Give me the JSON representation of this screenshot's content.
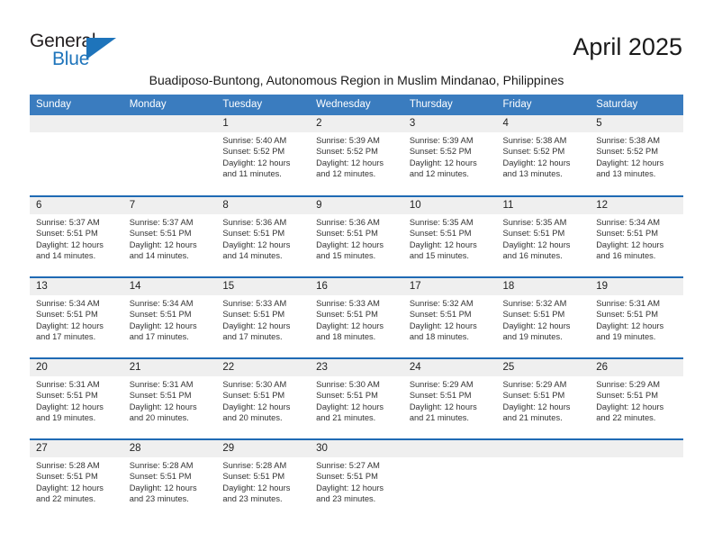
{
  "brand": {
    "word_one": "General",
    "word_two": "Blue",
    "triangle_icon": "triangle-icon",
    "primary_color": "#1e74bb"
  },
  "header": {
    "month_title": "April 2025",
    "subtitle": "Buadiposo-Buntong, Autonomous Region in Muslim Mindanao, Philippines"
  },
  "colors": {
    "header_blue": "#3a7cbf",
    "row_rule_blue": "#1f6ab4",
    "daynum_band": "#efefef"
  },
  "calendar": {
    "weekdays": [
      "Sunday",
      "Monday",
      "Tuesday",
      "Wednesday",
      "Thursday",
      "Friday",
      "Saturday"
    ],
    "weeks": [
      [
        {
          "day": "",
          "empty": true,
          "sunrise": "",
          "sunset": "",
          "daylight_line1": "",
          "daylight_line2": ""
        },
        {
          "day": "",
          "empty": true,
          "sunrise": "",
          "sunset": "",
          "daylight_line1": "",
          "daylight_line2": ""
        },
        {
          "day": "1",
          "sunrise": "Sunrise: 5:40 AM",
          "sunset": "Sunset: 5:52 PM",
          "daylight_line1": "Daylight: 12 hours",
          "daylight_line2": "and 11 minutes."
        },
        {
          "day": "2",
          "sunrise": "Sunrise: 5:39 AM",
          "sunset": "Sunset: 5:52 PM",
          "daylight_line1": "Daylight: 12 hours",
          "daylight_line2": "and 12 minutes."
        },
        {
          "day": "3",
          "sunrise": "Sunrise: 5:39 AM",
          "sunset": "Sunset: 5:52 PM",
          "daylight_line1": "Daylight: 12 hours",
          "daylight_line2": "and 12 minutes."
        },
        {
          "day": "4",
          "sunrise": "Sunrise: 5:38 AM",
          "sunset": "Sunset: 5:52 PM",
          "daylight_line1": "Daylight: 12 hours",
          "daylight_line2": "and 13 minutes."
        },
        {
          "day": "5",
          "sunrise": "Sunrise: 5:38 AM",
          "sunset": "Sunset: 5:52 PM",
          "daylight_line1": "Daylight: 12 hours",
          "daylight_line2": "and 13 minutes."
        }
      ],
      [
        {
          "day": "6",
          "sunrise": "Sunrise: 5:37 AM",
          "sunset": "Sunset: 5:51 PM",
          "daylight_line1": "Daylight: 12 hours",
          "daylight_line2": "and 14 minutes."
        },
        {
          "day": "7",
          "sunrise": "Sunrise: 5:37 AM",
          "sunset": "Sunset: 5:51 PM",
          "daylight_line1": "Daylight: 12 hours",
          "daylight_line2": "and 14 minutes."
        },
        {
          "day": "8",
          "sunrise": "Sunrise: 5:36 AM",
          "sunset": "Sunset: 5:51 PM",
          "daylight_line1": "Daylight: 12 hours",
          "daylight_line2": "and 14 minutes."
        },
        {
          "day": "9",
          "sunrise": "Sunrise: 5:36 AM",
          "sunset": "Sunset: 5:51 PM",
          "daylight_line1": "Daylight: 12 hours",
          "daylight_line2": "and 15 minutes."
        },
        {
          "day": "10",
          "sunrise": "Sunrise: 5:35 AM",
          "sunset": "Sunset: 5:51 PM",
          "daylight_line1": "Daylight: 12 hours",
          "daylight_line2": "and 15 minutes."
        },
        {
          "day": "11",
          "sunrise": "Sunrise: 5:35 AM",
          "sunset": "Sunset: 5:51 PM",
          "daylight_line1": "Daylight: 12 hours",
          "daylight_line2": "and 16 minutes."
        },
        {
          "day": "12",
          "sunrise": "Sunrise: 5:34 AM",
          "sunset": "Sunset: 5:51 PM",
          "daylight_line1": "Daylight: 12 hours",
          "daylight_line2": "and 16 minutes."
        }
      ],
      [
        {
          "day": "13",
          "sunrise": "Sunrise: 5:34 AM",
          "sunset": "Sunset: 5:51 PM",
          "daylight_line1": "Daylight: 12 hours",
          "daylight_line2": "and 17 minutes."
        },
        {
          "day": "14",
          "sunrise": "Sunrise: 5:34 AM",
          "sunset": "Sunset: 5:51 PM",
          "daylight_line1": "Daylight: 12 hours",
          "daylight_line2": "and 17 minutes."
        },
        {
          "day": "15",
          "sunrise": "Sunrise: 5:33 AM",
          "sunset": "Sunset: 5:51 PM",
          "daylight_line1": "Daylight: 12 hours",
          "daylight_line2": "and 17 minutes."
        },
        {
          "day": "16",
          "sunrise": "Sunrise: 5:33 AM",
          "sunset": "Sunset: 5:51 PM",
          "daylight_line1": "Daylight: 12 hours",
          "daylight_line2": "and 18 minutes."
        },
        {
          "day": "17",
          "sunrise": "Sunrise: 5:32 AM",
          "sunset": "Sunset: 5:51 PM",
          "daylight_line1": "Daylight: 12 hours",
          "daylight_line2": "and 18 minutes."
        },
        {
          "day": "18",
          "sunrise": "Sunrise: 5:32 AM",
          "sunset": "Sunset: 5:51 PM",
          "daylight_line1": "Daylight: 12 hours",
          "daylight_line2": "and 19 minutes."
        },
        {
          "day": "19",
          "sunrise": "Sunrise: 5:31 AM",
          "sunset": "Sunset: 5:51 PM",
          "daylight_line1": "Daylight: 12 hours",
          "daylight_line2": "and 19 minutes."
        }
      ],
      [
        {
          "day": "20",
          "sunrise": "Sunrise: 5:31 AM",
          "sunset": "Sunset: 5:51 PM",
          "daylight_line1": "Daylight: 12 hours",
          "daylight_line2": "and 19 minutes."
        },
        {
          "day": "21",
          "sunrise": "Sunrise: 5:31 AM",
          "sunset": "Sunset: 5:51 PM",
          "daylight_line1": "Daylight: 12 hours",
          "daylight_line2": "and 20 minutes."
        },
        {
          "day": "22",
          "sunrise": "Sunrise: 5:30 AM",
          "sunset": "Sunset: 5:51 PM",
          "daylight_line1": "Daylight: 12 hours",
          "daylight_line2": "and 20 minutes."
        },
        {
          "day": "23",
          "sunrise": "Sunrise: 5:30 AM",
          "sunset": "Sunset: 5:51 PM",
          "daylight_line1": "Daylight: 12 hours",
          "daylight_line2": "and 21 minutes."
        },
        {
          "day": "24",
          "sunrise": "Sunrise: 5:29 AM",
          "sunset": "Sunset: 5:51 PM",
          "daylight_line1": "Daylight: 12 hours",
          "daylight_line2": "and 21 minutes."
        },
        {
          "day": "25",
          "sunrise": "Sunrise: 5:29 AM",
          "sunset": "Sunset: 5:51 PM",
          "daylight_line1": "Daylight: 12 hours",
          "daylight_line2": "and 21 minutes."
        },
        {
          "day": "26",
          "sunrise": "Sunrise: 5:29 AM",
          "sunset": "Sunset: 5:51 PM",
          "daylight_line1": "Daylight: 12 hours",
          "daylight_line2": "and 22 minutes."
        }
      ],
      [
        {
          "day": "27",
          "sunrise": "Sunrise: 5:28 AM",
          "sunset": "Sunset: 5:51 PM",
          "daylight_line1": "Daylight: 12 hours",
          "daylight_line2": "and 22 minutes."
        },
        {
          "day": "28",
          "sunrise": "Sunrise: 5:28 AM",
          "sunset": "Sunset: 5:51 PM",
          "daylight_line1": "Daylight: 12 hours",
          "daylight_line2": "and 23 minutes."
        },
        {
          "day": "29",
          "sunrise": "Sunrise: 5:28 AM",
          "sunset": "Sunset: 5:51 PM",
          "daylight_line1": "Daylight: 12 hours",
          "daylight_line2": "and 23 minutes."
        },
        {
          "day": "30",
          "sunrise": "Sunrise: 5:27 AM",
          "sunset": "Sunset: 5:51 PM",
          "daylight_line1": "Daylight: 12 hours",
          "daylight_line2": "and 23 minutes."
        },
        {
          "day": "",
          "empty": true,
          "sunrise": "",
          "sunset": "",
          "daylight_line1": "",
          "daylight_line2": ""
        },
        {
          "day": "",
          "empty": true,
          "sunrise": "",
          "sunset": "",
          "daylight_line1": "",
          "daylight_line2": ""
        },
        {
          "day": "",
          "empty": true,
          "sunrise": "",
          "sunset": "",
          "daylight_line1": "",
          "daylight_line2": ""
        }
      ]
    ]
  }
}
